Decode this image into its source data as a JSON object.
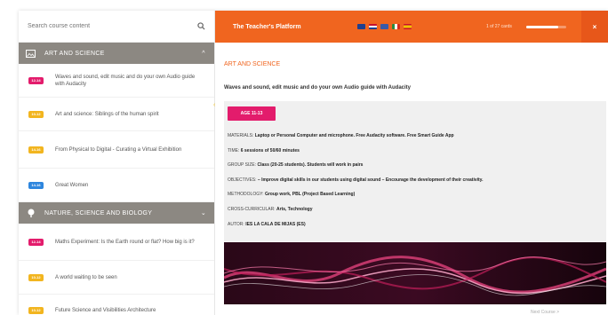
{
  "sidebar": {
    "search_placeholder": "Search course content",
    "sections": [
      {
        "label": "ART AND SCIENCE",
        "items": [
          {
            "badge": "12-14",
            "badge_color": "#e31c6c",
            "text": "Waves and sound, edit music and do your own Audio guide with Audacity"
          },
          {
            "badge": "10-12",
            "badge_color": "#f2b51f",
            "text": "Art and science: Siblings of the human spirit"
          },
          {
            "badge": "14-16",
            "badge_color": "#f2b51f",
            "text": "From Physical to Digital - Curating a Virtual Exhibition"
          },
          {
            "badge": "14-16",
            "badge_color": "#2e86de",
            "text": "Great Women"
          }
        ]
      },
      {
        "label": "NATURE, SCIENCE AND BIOLOGY",
        "items": [
          {
            "badge": "12-14",
            "badge_color": "#e31c6c",
            "text": "Maths Experiment: Is the Earth round or flat? How big is it?"
          },
          {
            "badge": "10-12",
            "badge_color": "#f2b51f",
            "text": "A world waiting to be seen"
          },
          {
            "badge": "10-12",
            "badge_color": "#f2b51f",
            "text": "Future Science and Visibilities Architecture"
          }
        ]
      }
    ]
  },
  "topbar": {
    "title": "The Teacher's Platform",
    "flags": [
      "#1f3f8f",
      "#c8102e",
      "#3a5aa8",
      "#f5f5f5",
      "#f2c200"
    ],
    "counter": "1 of 27 cards",
    "progress": 0.04,
    "close": "×"
  },
  "content": {
    "section": "ART AND SCIENCE",
    "subtitle": "Waves and sound, edit music and do your own Audio guide with Audacity",
    "age": "AGE 11-13",
    "meta": [
      {
        "label": "MATERIALS:",
        "value": "Laptop or Personal Computer and microphone. Free Audacity software. Free Smart Guide App"
      },
      {
        "label": "TIME:",
        "value": "6 sessions of 50/60 minutes"
      },
      {
        "label": "GROUP SIZE:",
        "value": "Class (20-25 students). Students will work in pairs"
      },
      {
        "label": "OBJECTIVES:",
        "value": "– Improve digital skills in our students using digital sound – Encourage the development of their creativity."
      },
      {
        "label": "METHODOLOGY:",
        "value": "Group work, PBL (Project Based Learning)"
      },
      {
        "label": "CROSS-CURRICULAR:",
        "value": "Arts, Technology"
      },
      {
        "label": "AUTOR:",
        "value": "IES LA CALA DE MIJAS (ES)"
      }
    ],
    "next_link": "Next Course >"
  }
}
